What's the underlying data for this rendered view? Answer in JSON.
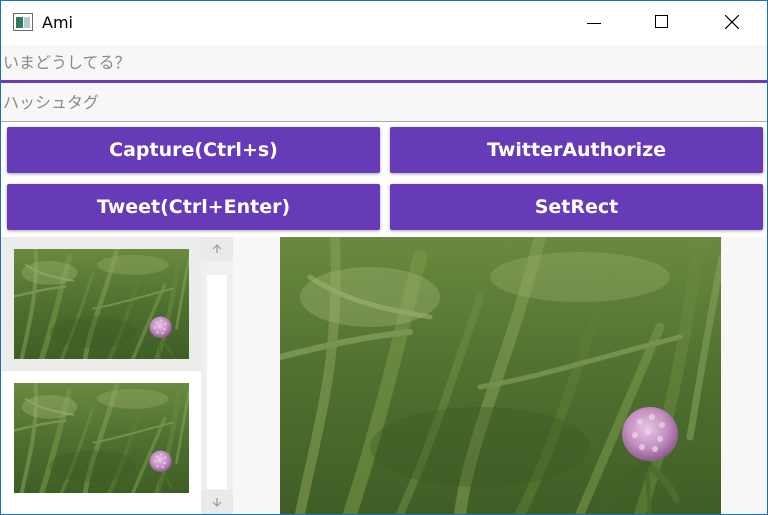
{
  "window": {
    "title": "Ami",
    "icon": "app-icon",
    "controls": [
      "minimize-icon",
      "maximize-icon",
      "close-icon"
    ]
  },
  "inputs": {
    "status_placeholder": "いまどうしてる？",
    "hashtag_placeholder": "ハッシュタグ"
  },
  "buttons": {
    "capture": "Capture(Ctrl+s)",
    "twitter_authorize": "TwitterAuthorize",
    "tweet": "Tweet(Ctrl+Enter)",
    "set_rect": "SetRect"
  },
  "capture_list": {
    "items": [
      {
        "image": "clover-flower-photo",
        "selected": true
      },
      {
        "image": "clover-flower-photo",
        "selected": false
      }
    ],
    "scroll_up_icon": "arrow-up-icon",
    "scroll_down_icon": "arrow-down-icon"
  },
  "preview": {
    "image": "clover-flower-photo"
  },
  "colors": {
    "accent": "#673ab7",
    "button_text": "#ffffff",
    "field_background": "#f7f7f7",
    "window_border": "#1f6fb8"
  }
}
